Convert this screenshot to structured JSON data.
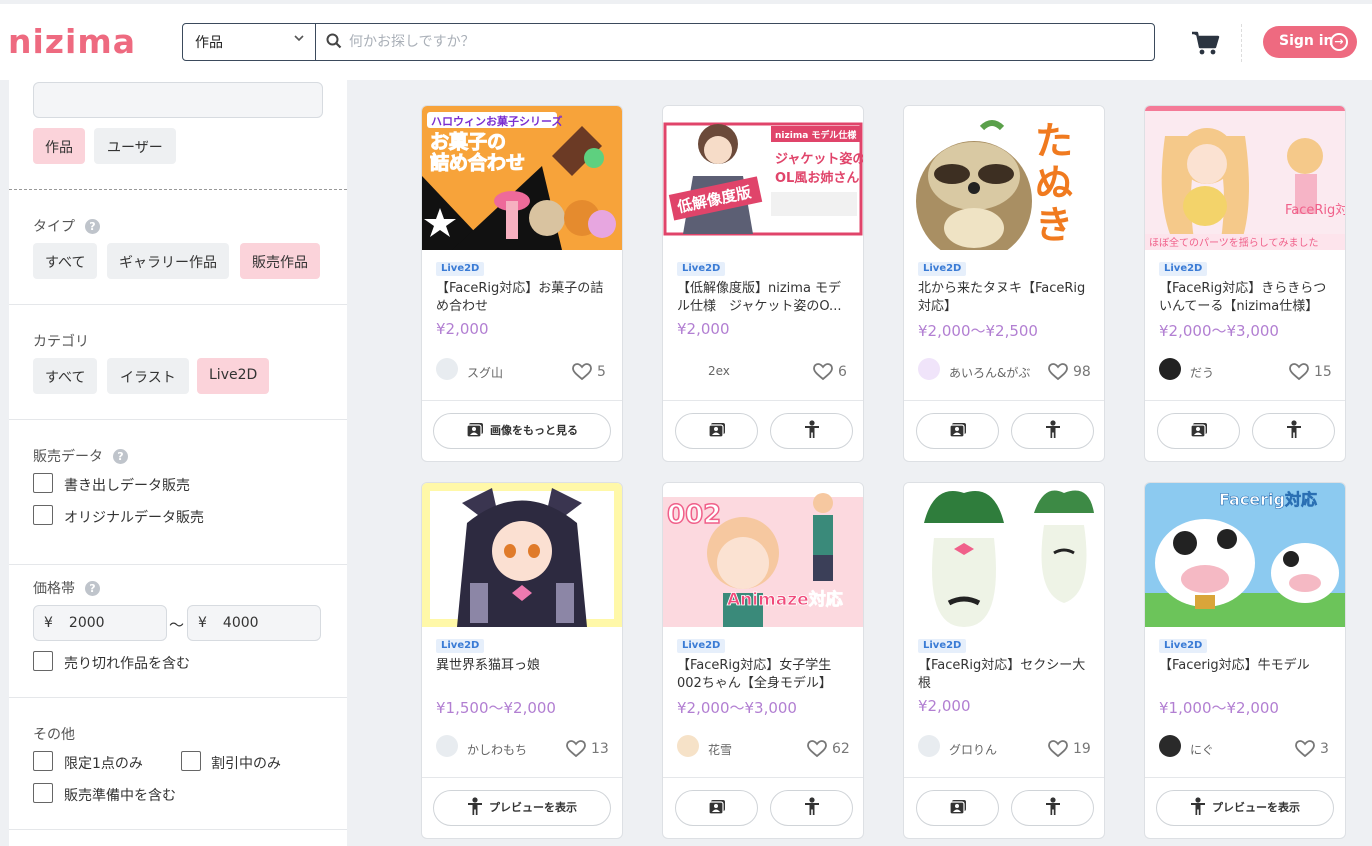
{
  "header": {
    "logo": "nizima",
    "search_scope": "作品",
    "search_placeholder": "何かお探しですか？",
    "signin_label": "Sign in"
  },
  "sidebar": {
    "search_value": "",
    "scope_tabs": [
      {
        "label": "作品",
        "selected": true
      },
      {
        "label": "ユーザー",
        "selected": false
      }
    ],
    "type": {
      "title": "タイプ",
      "options": [
        {
          "label": "すべて",
          "selected": false
        },
        {
          "label": "ギャラリー作品",
          "selected": false
        },
        {
          "label": "販売作品",
          "selected": true
        }
      ]
    },
    "category": {
      "title": "カテゴリ",
      "options": [
        {
          "label": "すべて",
          "selected": false
        },
        {
          "label": "イラスト",
          "selected": false
        },
        {
          "label": "Live2D",
          "selected": true
        }
      ]
    },
    "sales_data": {
      "title": "販売データ",
      "checkboxes": [
        {
          "label": "書き出しデータ販売",
          "checked": false
        },
        {
          "label": "オリジナルデータ販売",
          "checked": false
        }
      ]
    },
    "price": {
      "title": "価格帯",
      "currency": "¥",
      "min": "2000",
      "max": "4000",
      "separator": "〜",
      "soldout_label": "売り切れ作品を含む"
    },
    "other": {
      "title": "その他",
      "checkboxes": [
        {
          "label": "限定1点のみ",
          "checked": false
        },
        {
          "label": "割引中のみ",
          "checked": false
        },
        {
          "label": "販売準備中を含む",
          "checked": false
        }
      ]
    }
  },
  "colors": {
    "brand": "#ee6a80",
    "price": "#b27fd2",
    "selected_chip": "#fbd3da",
    "badge_text": "#3a7bd5"
  },
  "products": [
    {
      "badge": "Live2D",
      "title": "【FaceRig対応】お菓子の詰め合わせ",
      "price": "¥2,000",
      "user": "スグ山",
      "likes": "5",
      "button": "画像をもっと見る",
      "layout": "single-gallery",
      "thumb_text": [
        "ハロウィンお菓子シリーズ",
        "お菓子の",
        "詰め合わせ"
      ]
    },
    {
      "badge": "Live2D",
      "title": "【低解像度版】nizima モデル仕様　ジャケット姿のO...",
      "price": "¥2,000",
      "user": "2ex",
      "likes": "6",
      "layout": "double",
      "thumb_text": [
        "nizima モデル仕様",
        "ジャケット姿の",
        "OL風お姉さん",
        "低解像度版"
      ]
    },
    {
      "badge": "Live2D",
      "title": "北から来たタヌキ【FaceRig対応】",
      "price": "¥2,000〜¥2,500",
      "user": "あいろん&がぶ",
      "likes": "98",
      "layout": "double",
      "thumb_text": [
        "たぬき"
      ]
    },
    {
      "badge": "Live2D",
      "title": "【FaceRig対応】きらきらついんてーる【nizima仕様】",
      "price": "¥2,000〜¥3,000",
      "user": "だう",
      "likes": "15",
      "layout": "double",
      "thumb_text": [
        "FaceRig対応",
        "ほぼ全てのパーツを揺らしてみました"
      ]
    },
    {
      "badge": "Live2D",
      "title": "異世界系猫耳っ娘",
      "price": "¥1,500〜¥2,000",
      "user": "かしわもち",
      "likes": "13",
      "button": "プレビューを表示",
      "layout": "single-preview",
      "thumb_text": []
    },
    {
      "badge": "Live2D",
      "title": "【FaceRig対応】女子学生002ちゃん【全身モデル】",
      "price": "¥2,000〜¥3,000",
      "user": "花雪",
      "likes": "62",
      "layout": "double",
      "thumb_text": [
        "002",
        "Animaze対応"
      ]
    },
    {
      "badge": "Live2D",
      "title": "【FaceRig対応】セクシー大根",
      "price": "¥2,000",
      "user": "グロりん",
      "likes": "19",
      "layout": "double",
      "thumb_text": []
    },
    {
      "badge": "Live2D",
      "title": "【Facerig対応】牛モデル",
      "price": "¥1,000〜¥2,000",
      "user": "にぐ",
      "likes": "3",
      "button": "プレビューを表示",
      "layout": "single-preview",
      "thumb_text": [
        "Facerig対応"
      ]
    }
  ]
}
